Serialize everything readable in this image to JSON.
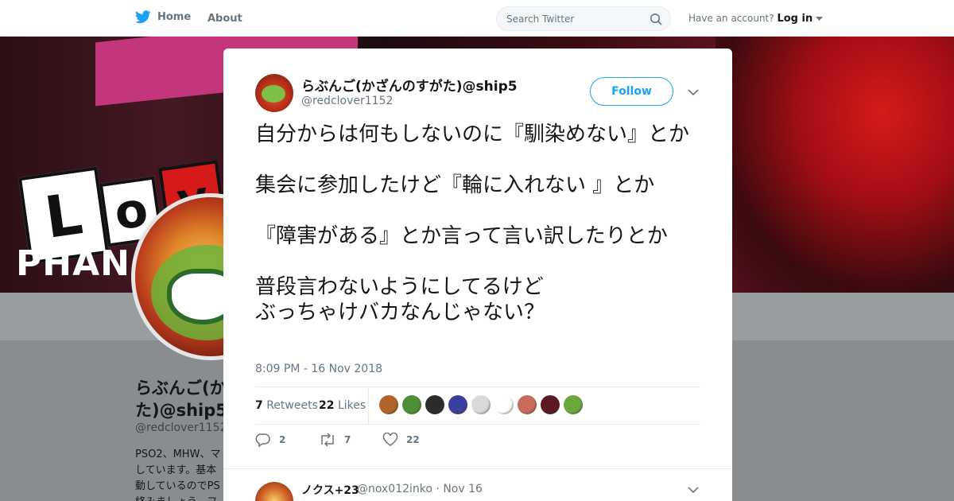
{
  "nav": {
    "home_label": "Home",
    "about_label": "About",
    "search_placeholder": "Search Twitter",
    "account_prompt": "Have an account?",
    "login_label": "Log in",
    "brand_color": "#1da1f2"
  },
  "background_profile": {
    "banner_letters": [
      "L",
      "o",
      "v"
    ],
    "banner_word": "PHAN",
    "name": "らぶんご(か\nた)@ship5",
    "handle": "@redclover1152",
    "bio": "PSO2、MHW、マ\nしています。基本\n動しているのでPS\n絡みましょう。フ"
  },
  "tweet": {
    "display_name": "らぶんご(かざんのすがた)@ship5",
    "handle": "@redclover1152",
    "follow_label": "Follow",
    "text": "自分からは何もしないのに『馴染めない』とか\n\n集会に参加したけど『輪に入れない 』とか\n\n『障害がある』とか言って言い訳したりとか\n\n普段言わないようにしてるけど\nぶっちゃけバカなんじゃない？",
    "timestamp": "8:09 PM - 16 Nov 2018",
    "retweets_count": "7",
    "retweets_label": "Retweets",
    "likes_count": "22",
    "likes_label": "Likes",
    "liker_colors": [
      "#b0642a",
      "#4e8f3a",
      "#2b2b2b",
      "#3b3f9e",
      "#d9d9d9",
      "#ffffff",
      "#c86b5a",
      "#5a1a24",
      "#6aa83c"
    ],
    "reply_count": "2",
    "retweet_count": "7",
    "like_count": "22"
  },
  "reply": {
    "display_name": "ノクス+23",
    "handle": "@nox012inko",
    "date": "Nov 16"
  }
}
